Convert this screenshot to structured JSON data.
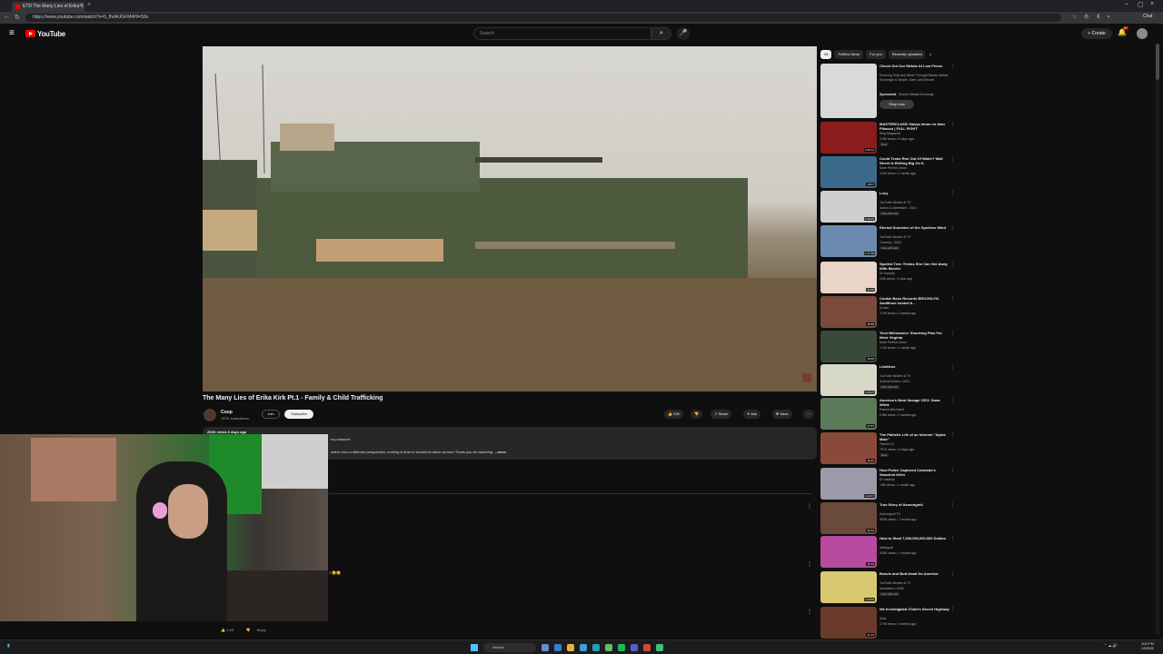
{
  "browser": {
    "tab_title": "ETD The Many Lies of Erika K",
    "url": "https://www.youtube.com/watch?v=5_fhd4UGFM4Ht=50s",
    "profile": "Chat"
  },
  "header": {
    "logo": "YouTube",
    "search_placeholder": "Search",
    "create_label": "Create",
    "notif_count": "9+"
  },
  "video": {
    "title": "The Many Lies of Erika Kirk Pt.1 - Family & Child Trafficking",
    "channel": "Coop",
    "subscribers": "197K subscribers",
    "join_label": "Join",
    "subscribe_label": "Subscribe",
    "likes": "22K",
    "share_label": "Share",
    "ask_label": "Ask",
    "save_label": "Save",
    "views_meta": "252K views 6 days ago",
    "desc_line1": "my channel!",
    "desc_line2": "ective from a different perspective, nothing is final or should be taken as fact! Thank you for watching",
    "more_label": "...more"
  },
  "comments": {
    "emoji_line": "7 😄😄",
    "likes": "1.9K",
    "reply_label": "Reply"
  },
  "chips": [
    "All",
    "Politics News",
    "For you",
    "Recently uploaded"
  ],
  "recommendations": [
    {
      "title": "Check Out Our Metals At Low Prices",
      "desc": "Sourcing Gold and Silver Through Money Metals Exchange Is Simple, Safe, and Secure.",
      "sponsored": "Sponsored",
      "advertiser": "Money Metals Exchange",
      "cta": "Shop now",
      "thumb_color": "#d9d9d9"
    },
    {
      "title": "MASTERCLASS! Nasya Imran vs Alan Pikasso | FULL FIGHT",
      "channel": "Ring Magazine",
      "meta": "2.5M views • 6 days ago",
      "badge": "New",
      "duration": "1:02:14",
      "thumb_color": "#8a1c1c"
    },
    {
      "title": "Could Texas Run Out Of Water? Wall Street Is Betting Big On It.",
      "channel": "More Perfect Union",
      "meta": "3.6M views • 1 month ago",
      "duration": "18:07",
      "thumb_color": "#3c6a8a"
    },
    {
      "title": "Lucy",
      "channel": "YouTube Movies & TV",
      "meta": "Action & adventure • 2014",
      "badge": "Free with ads",
      "duration": "1:29:32",
      "thumb_color": "#cfcfcf"
    },
    {
      "title": "Eternal Sunshine of the Spotless Mind",
      "channel": "YouTube Movies & TV",
      "meta": "Comedy • 2004",
      "badge": "Free with ads",
      "duration": "1:47:48",
      "thumb_color": "#6a8ab0"
    },
    {
      "title": "Spoiled Teen Thinks She Can Get Away With Murder",
      "channel": "Dr Insanity",
      "meta": "19M views • 1 year ago",
      "duration": "52:09",
      "thumb_color": "#e8d5c8"
    },
    {
      "title": "Cookie Boss Records BROOKLYN Auditions hosted b...",
      "channel": "Druski",
      "meta": "3.2M views • 2 weeks ago",
      "duration": "48:58",
      "thumb_color": "#7a4a3a"
    },
    {
      "title": "Tech Billionaires' Shocking Plan For West Virginia",
      "channel": "More Perfect Union",
      "meta": "1.1M views • 1 month ago",
      "duration": "18:09",
      "thumb_color": "#3a4a3a"
    },
    {
      "title": "Limitless",
      "channel": "YouTube Movies & TV",
      "meta": "Science fiction • 2011",
      "badge": "Free with ads",
      "duration": "1:45:07",
      "thumb_color": "#d8d8c8"
    },
    {
      "title": "America's Most Savage CEO: Dana White",
      "channel": "Patrick Bet-David",
      "meta": "2.8M views • 2 weeks ago",
      "duration": "27:57",
      "thumb_color": "#5a7a5a"
    },
    {
      "title": "The Pathetic Life of an Internet \"Alpha Male\"",
      "channel": "Patrick Co",
      "meta": "757K views • 6 days ago",
      "badge": "New",
      "duration": "49:22",
      "thumb_color": "#8a4a3a"
    },
    {
      "title": "How Police Captured Colorado's Smartest Killer",
      "channel": "Dr Insanity",
      "meta": "14M views • 1 month ago",
      "duration": "1:22:17",
      "thumb_color": "#9a9aaa"
    },
    {
      "title": "True Story of Asmongold",
      "channel": "Asmongold TV",
      "meta": "953K views • 1 month ago",
      "duration": "30:24",
      "thumb_color": "#6a4a3a"
    },
    {
      "title": "How to Steal 7,000,000,000,000 Dollars",
      "channel": "Nebugold",
      "meta": "518K views • 1 month ago",
      "duration": "25:10",
      "thumb_color": "#b84aa0"
    },
    {
      "title": "Beavis and Butt-Head Do America",
      "channel": "YouTube Movies & TV",
      "meta": "Animation • 1996",
      "badge": "Free with ads",
      "duration": "1:20:50",
      "thumb_color": "#d8c870"
    },
    {
      "title": "We Investigated China's Secret Highway",
      "channel": "Sina",
      "meta": "2.7M views • 3 weeks ago",
      "duration": "21:13",
      "thumb_color": "#6a3a2a"
    }
  ],
  "taskbar": {
    "search_label": "Search",
    "time": "8:43 PM",
    "date": "1/5/2026"
  }
}
